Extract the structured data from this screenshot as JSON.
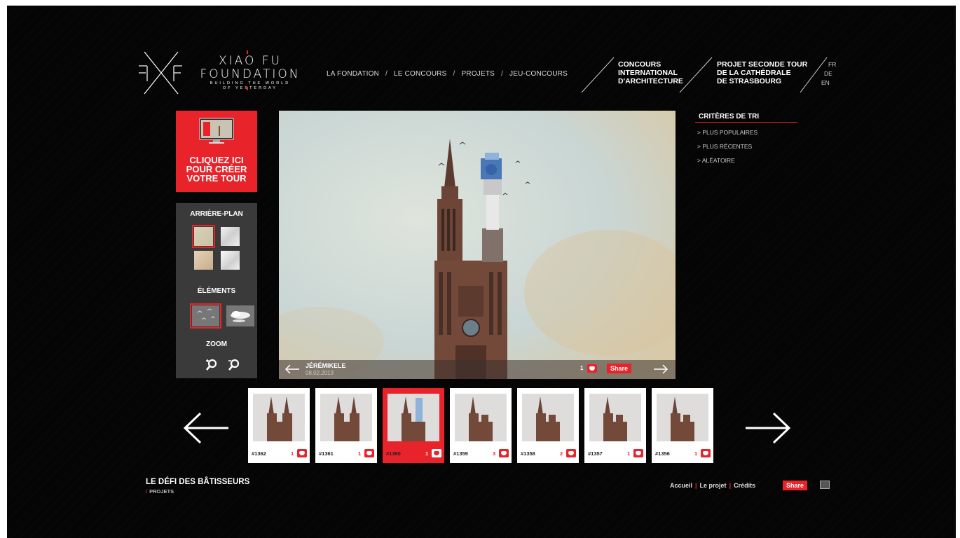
{
  "logo": {
    "line1": "XIAO FU",
    "line2": "FOUNDATION",
    "line3": "BUILDING THE WORLD",
    "line4": "OF YESTERDAY"
  },
  "nav": {
    "items": [
      "LA FONDATION",
      "LE CONCOURS",
      "PROJETS",
      "JEU-CONCOURS"
    ],
    "separator": "/"
  },
  "concours_link": [
    "CONCOURS",
    "INTERNATIONAL",
    "D'ARCHITECTURE"
  ],
  "projet_link": [
    "PROJET SECONDE TOUR",
    "DE LA CATHÉDRALE",
    "DE STRASBOURG"
  ],
  "languages": [
    "FR",
    "DE",
    "EN"
  ],
  "cta": {
    "lines": [
      "CLIQUEZ ICI",
      "POUR CRÉER",
      "VOTRE TOUR"
    ]
  },
  "tools": {
    "background_label": "ARRIÈRE-PLAN",
    "elements_label": "ÉLÉMENTS",
    "zoom_label": "ZOOM"
  },
  "viewer": {
    "author": "JÉRÉMIKELE",
    "date": "08.02.2013",
    "likes": "1",
    "share_label": "Share"
  },
  "sort": {
    "title": "CRITÈRES DE TRI",
    "items": [
      "> PLUS POPULAIRES",
      "> PLUS RÉCENTES",
      "> ALÉATOIRE"
    ]
  },
  "thumbnails": [
    {
      "id": "#1362",
      "likes": "1"
    },
    {
      "id": "#1361",
      "likes": "1"
    },
    {
      "id": "#1360",
      "likes": "1"
    },
    {
      "id": "#1359",
      "likes": "3"
    },
    {
      "id": "#1358",
      "likes": "2"
    },
    {
      "id": "#1357",
      "likes": "1"
    },
    {
      "id": "#1356",
      "likes": "1"
    }
  ],
  "selected_thumbnail": 2,
  "footer": {
    "title": "LE DÉFI DES BÂTISSEURS",
    "crumb_sep": "/",
    "crumb": "PROJETS",
    "links": [
      "Accueil",
      "Le projet",
      "Crédits"
    ],
    "link_sep": "|",
    "share_label": "Share"
  },
  "colors": {
    "accent": "#e8232a",
    "background": "#050505",
    "panel": "#3a3a3a"
  }
}
